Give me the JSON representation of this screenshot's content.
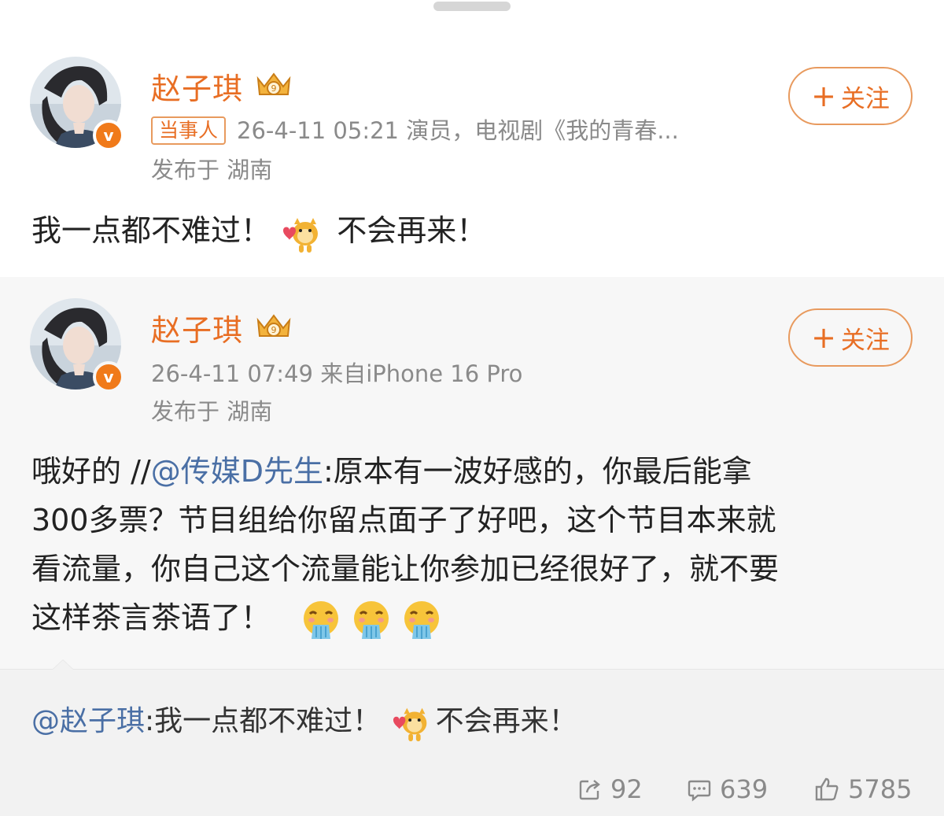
{
  "post1": {
    "username": "赵子琪",
    "tag": "当事人",
    "meta": "26-4-11 05:21  演员，电视剧《我的青春...",
    "location": "发布于 湖南",
    "follow_label": "关注",
    "text_a": "我一点都不难过！",
    "text_b": "不会再来！"
  },
  "post2": {
    "username": "赵子琪",
    "meta": "26-4-11 07:49  来自iPhone 16 Pro",
    "location": "发布于 湖南",
    "follow_label": "关注",
    "line1_a": "哦好的 //",
    "line1_link": "@传媒D先生",
    "line1_b": ":原本有一波好感的，你最后能拿",
    "line2": "300多票？节目组给你留点面子了好吧，这个节目本来就",
    "line3": "看流量，你自己这个流量能让你参加已经很好了，就不要",
    "line4": "这样茶言茶语了！"
  },
  "quoted": {
    "mention": "@赵子琪",
    "text_a": ":我一点都不难过！",
    "text_b": "不会再来！"
  },
  "stats": {
    "reposts": "92",
    "comments": "639",
    "likes": "5785"
  },
  "colors": {
    "username": "#e86e24",
    "link": "#4a6fa5",
    "verified_badge": "#f07a1a"
  },
  "icons": [
    "verified-badge-icon",
    "crown-level-icon",
    "hamster-heart-emoji",
    "vomit-emoji",
    "repost-icon",
    "comment-icon",
    "like-icon"
  ]
}
